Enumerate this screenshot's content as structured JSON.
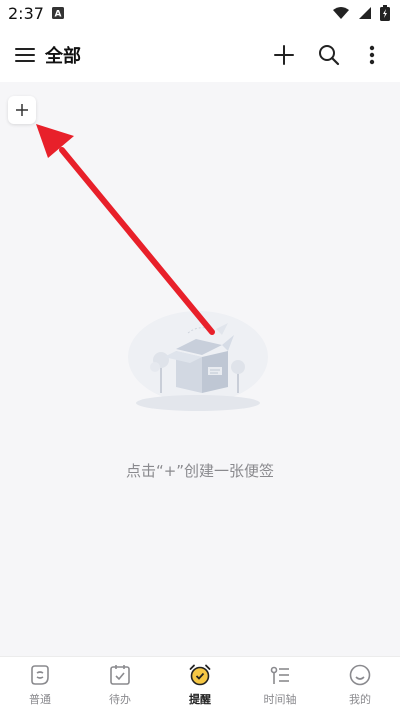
{
  "status_bar": {
    "time": "2:37",
    "app_icon": "A",
    "icons": [
      "wifi-icon",
      "signal-icon",
      "battery-icon"
    ]
  },
  "header": {
    "title": "全部",
    "icons": [
      "menu-icon",
      "plus-icon",
      "search-icon",
      "more-vertical-icon"
    ]
  },
  "content": {
    "add_button_label": "+",
    "empty_message": "点击“+”创建一张便签"
  },
  "bottom_nav": {
    "items": [
      {
        "label": "普通",
        "icon": "note-icon"
      },
      {
        "label": "待办",
        "icon": "checklist-icon"
      },
      {
        "label": "提醒",
        "icon": "alarm-clock-icon"
      },
      {
        "label": "时间轴",
        "icon": "timeline-icon"
      },
      {
        "label": "我的",
        "icon": "smile-icon"
      }
    ],
    "active": "提醒"
  },
  "colors": {
    "background": "#f6f6f8",
    "accent_yellow": "#f6c744",
    "arrow_red": "#e8202a",
    "muted_text": "#8a8a8e"
  }
}
